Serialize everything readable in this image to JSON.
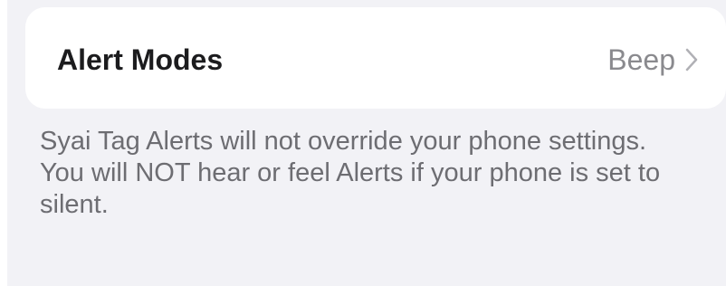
{
  "alert_modes": {
    "title": "Alert Modes",
    "value": "Beep",
    "chevron_icon": "chevron-right-icon"
  },
  "footer": {
    "line1": "Syai Tag Alerts will not override your phone settings.",
    "line2": "You will NOT hear or feel Alerts if your phone is set to silent."
  },
  "colors": {
    "background": "#f2f2f6",
    "card": "#ffffff",
    "title": "#1c1c1e",
    "secondary": "#8a8a8e",
    "footer_text": "#6d6d72"
  }
}
